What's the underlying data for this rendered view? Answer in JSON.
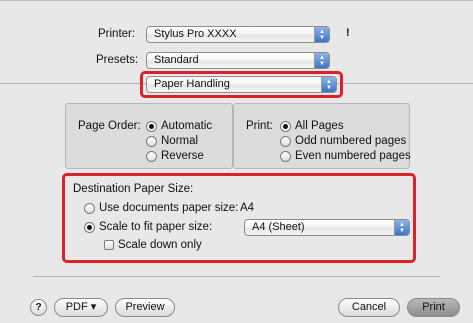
{
  "printer": {
    "label": "Printer:",
    "value": "Stylus Pro XXXX",
    "status_icon": "!"
  },
  "presets": {
    "label": "Presets:",
    "value": "Standard"
  },
  "panel_select": {
    "value": "Paper Handling"
  },
  "page_order": {
    "label": "Page Order:",
    "options": [
      "Automatic",
      "Normal",
      "Reverse"
    ],
    "selected": "Automatic"
  },
  "print_pages": {
    "label": "Print:",
    "options": [
      "All Pages",
      "Odd numbered pages",
      "Even numbered pages"
    ],
    "selected": "All Pages"
  },
  "destination": {
    "title": "Destination Paper Size:",
    "use_documents_label": "Use documents paper size:",
    "use_documents_value": "A4",
    "scale_label": "Scale to fit paper size:",
    "scale_value": "A4 (Sheet)",
    "scale_down_label": "Scale down only",
    "selected": "Scale to fit paper size"
  },
  "footer": {
    "help_label": "?",
    "pdf_label": "PDF ▾",
    "preview_label": "Preview",
    "cancel_label": "Cancel",
    "print_label": "Print"
  },
  "colors": {
    "highlight": "#d9232a",
    "popup_arrow": "#3d74c6"
  }
}
